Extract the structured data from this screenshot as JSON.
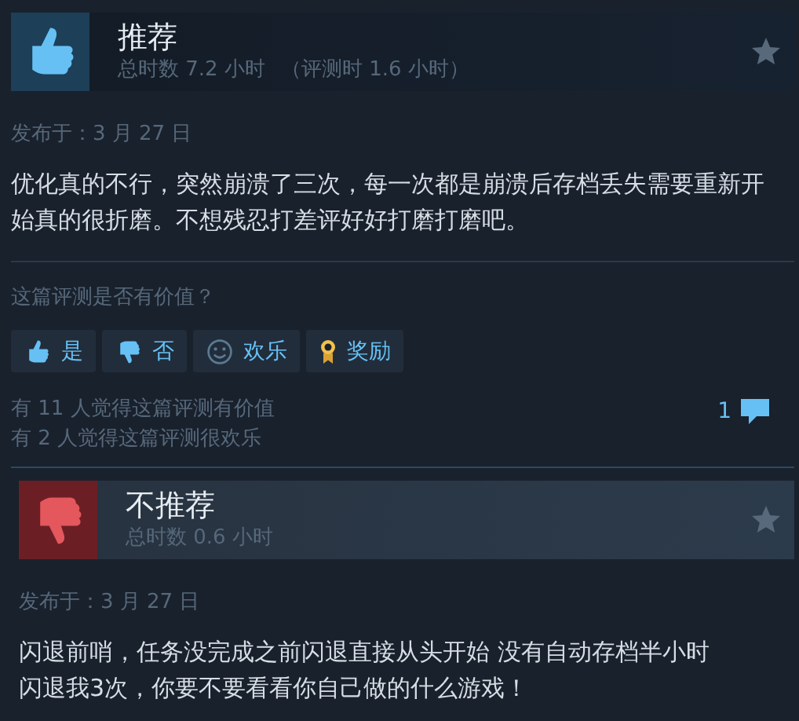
{
  "reviews": [
    {
      "kind": "recommended",
      "verdict": "推荐",
      "hours": "总时数 7.2 小时",
      "review_hours": "（评测时 1.6 小时）",
      "posted": "发布于：3 月 27 日",
      "text": "优化真的不行，突然崩溃了三次，每一次都是崩溃后存档丢失需要重新开始真的很折磨。不想残忍打差评好好打磨打磨吧。",
      "feedback": {
        "question": "这篇评测是否有价值？",
        "buttons": [
          {
            "kind": "yes",
            "label": "是"
          },
          {
            "kind": "no",
            "label": "否"
          },
          {
            "kind": "funny",
            "label": "欢乐"
          },
          {
            "kind": "award",
            "label": "奖励"
          }
        ],
        "counts": [
          "有 11 人觉得这篇评测有价值",
          "有 2 人觉得这篇评测很欢乐"
        ],
        "comments": "1"
      }
    },
    {
      "kind": "not_recommended",
      "verdict": "不推荐",
      "hours": "总时数 0.6 小时",
      "posted": "发布于：3 月 27 日",
      "text": "闪退前哨，任务没完成之前闪退直接从头开始 没有自动存档半小时闪退我3次，你要不要看看你自己做的什么游戏！"
    }
  ]
}
